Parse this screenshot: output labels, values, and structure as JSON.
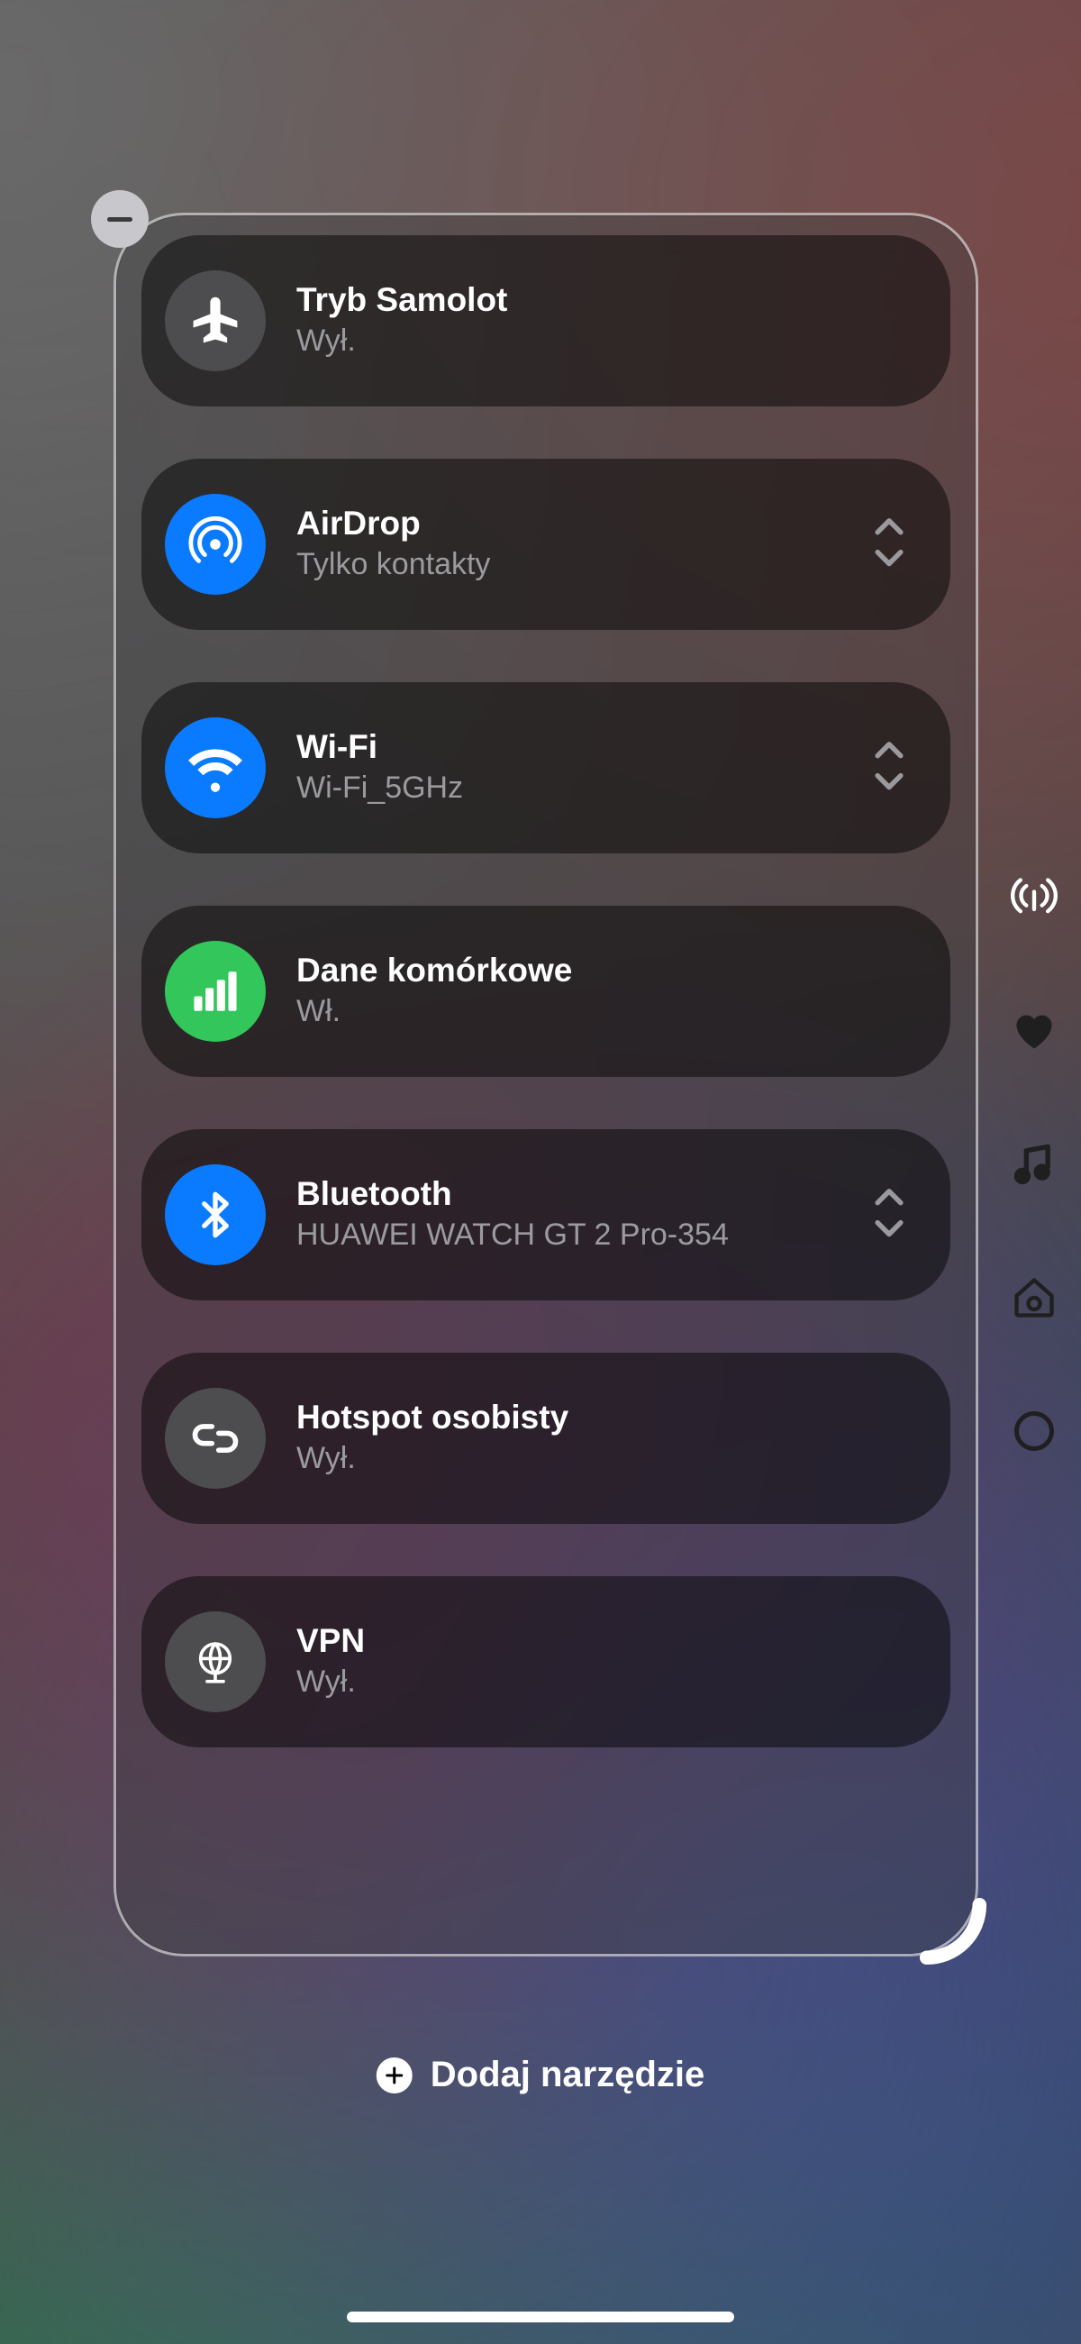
{
  "colors": {
    "blue": "#0a7bff",
    "green": "#33c65a",
    "gray": "#4d4d4f"
  },
  "rows": {
    "airplane": {
      "title": "Tryb Samolot",
      "subtitle": "Wył."
    },
    "airdrop": {
      "title": "AirDrop",
      "subtitle": "Tylko kontakty"
    },
    "wifi": {
      "title": "Wi-Fi",
      "subtitle": "Wi-Fi_5GHz"
    },
    "cellular": {
      "title": "Dane komórkowe",
      "subtitle": "Wł."
    },
    "bluetooth": {
      "title": "Bluetooth",
      "subtitle": "HUAWEI WATCH GT 2 Pro-354"
    },
    "hotspot": {
      "title": "Hotspot osobisty",
      "subtitle": "Wył."
    },
    "vpn": {
      "title": "VPN",
      "subtitle": "Wył."
    }
  },
  "add_widget_label": "Dodaj narzędzie",
  "side_categories": [
    "connectivity",
    "favorites",
    "music",
    "home",
    "other"
  ]
}
